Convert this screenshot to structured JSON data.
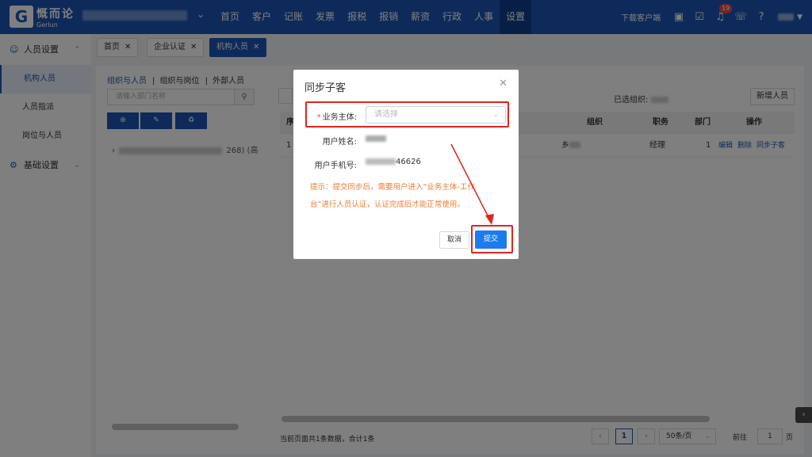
{
  "header": {
    "brand": "慨而论",
    "brand_sub": "Gerlun",
    "nav": [
      "首页",
      "客户",
      "记账",
      "发票",
      "报税",
      "报销",
      "薪资",
      "行政",
      "人事",
      "设置"
    ],
    "download_label": "下载客户端",
    "notification_count": "19",
    "colors": {
      "bar": "#1d55b5",
      "active": "#0f3e8f"
    }
  },
  "sidebar": {
    "groups": [
      {
        "label": "人员设置",
        "icon": "user-settings-icon"
      },
      {
        "label": "基础设置",
        "icon": "gear-icon"
      }
    ],
    "items": [
      "机构人员",
      "人员指派",
      "岗位与人员"
    ]
  },
  "tabs": [
    {
      "label": "首页",
      "close": "✕"
    },
    {
      "label": "企业认证",
      "close": "✕"
    },
    {
      "label": "机构人员",
      "close": "✕"
    }
  ],
  "left_panel": {
    "tabs": [
      "组织与人员",
      "组织与岗位",
      "外部人员"
    ],
    "search_placeholder": "请输入部门名称",
    "tree_suffix": "268) (高"
  },
  "right_panel": {
    "selected_org_label": "已选组织:",
    "new_button": "新增人员",
    "columns": [
      "序",
      "组织",
      "职务",
      "部门",
      "操作"
    ],
    "row": {
      "index": "1",
      "org_prefix": "乡",
      "position": "经理",
      "dept": "1",
      "ops": [
        "编辑",
        "删除",
        "同步子客"
      ]
    },
    "footer_count": "当前页面共1条数据，合计1条",
    "page_current": "1",
    "page_size": "50条/页",
    "goto_label": "前往",
    "goto_value": "1",
    "page_unit": "页"
  },
  "modal": {
    "title": "同步子客",
    "required_mark": "*",
    "fields": {
      "entity_label": "业务主体:",
      "entity_placeholder": "请选择",
      "name_label": "用户姓名:",
      "phone_label": "用户手机号:",
      "phone_suffix": "46626"
    },
    "hint_line1": "提示：提交同步后，需要用户进入“业务主体-工作",
    "hint_line2": "台”进行人员认证，认证完成后才能正常使用。",
    "cancel": "取消",
    "submit": "提交",
    "colors": {
      "hint": "#f07b2d",
      "submit": "#1d7bf0",
      "annotation": "#e0241f"
    }
  }
}
